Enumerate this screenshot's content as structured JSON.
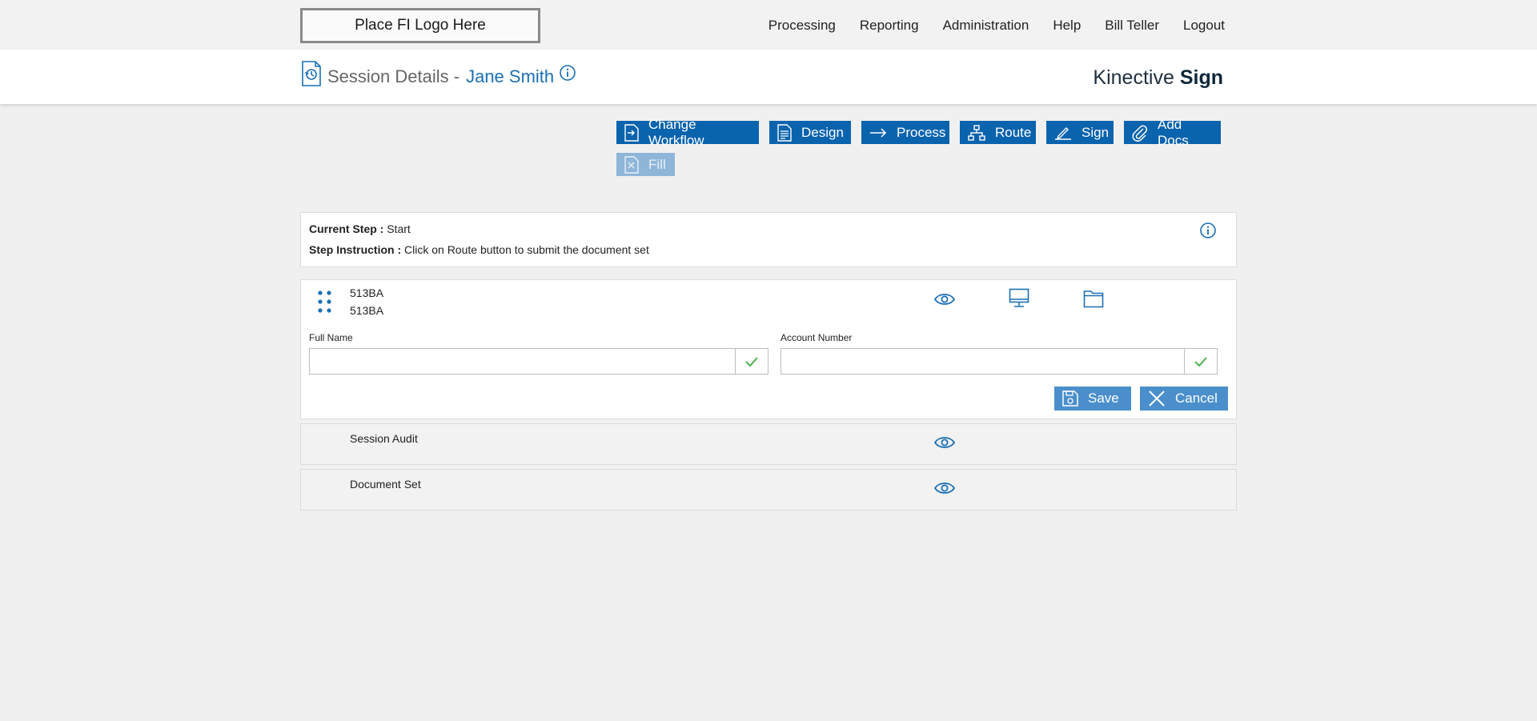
{
  "header": {
    "logo_text": "Place FI Logo Here",
    "nav": [
      "Processing",
      "Reporting",
      "Administration",
      "Help",
      "Bill Teller",
      "Logout"
    ]
  },
  "subheader": {
    "title_prefix": "Session Details -",
    "title_name": "Jane Smith",
    "brand_light": "Kinective",
    "brand_bold": "Sign"
  },
  "toolbar": {
    "change_workflow": "Change Workflow",
    "design": "Design",
    "process": "Process",
    "route": "Route",
    "sign": "Sign",
    "add_docs": "Add Docs",
    "fill": "Fill"
  },
  "step": {
    "current_label": "Current Step :",
    "current_value": "Start",
    "instruction_label": "Step Instruction :",
    "instruction_value": "Click on Route button to submit the document set"
  },
  "document": {
    "line1": "513BA",
    "line2": "513BA",
    "fields": [
      {
        "label": "Full Name",
        "value": "",
        "placeholder": ""
      },
      {
        "label": "Account Number",
        "value": "",
        "placeholder": ""
      }
    ],
    "save_label": "Save",
    "cancel_label": "Cancel"
  },
  "rows": [
    {
      "label": "Session Audit"
    },
    {
      "label": "Document Set"
    }
  ],
  "colors": {
    "primary": "#0a63ad",
    "link": "#1b6fb5",
    "disabled": "#8fb6d9",
    "check": "#4caf50"
  },
  "icons": {
    "session": "session-history-icon",
    "info": "info-icon",
    "drag": "drag-handle-icon",
    "view": "eye-icon",
    "monitor": "monitor-icon",
    "folder": "folder-icon",
    "check": "check-icon"
  }
}
